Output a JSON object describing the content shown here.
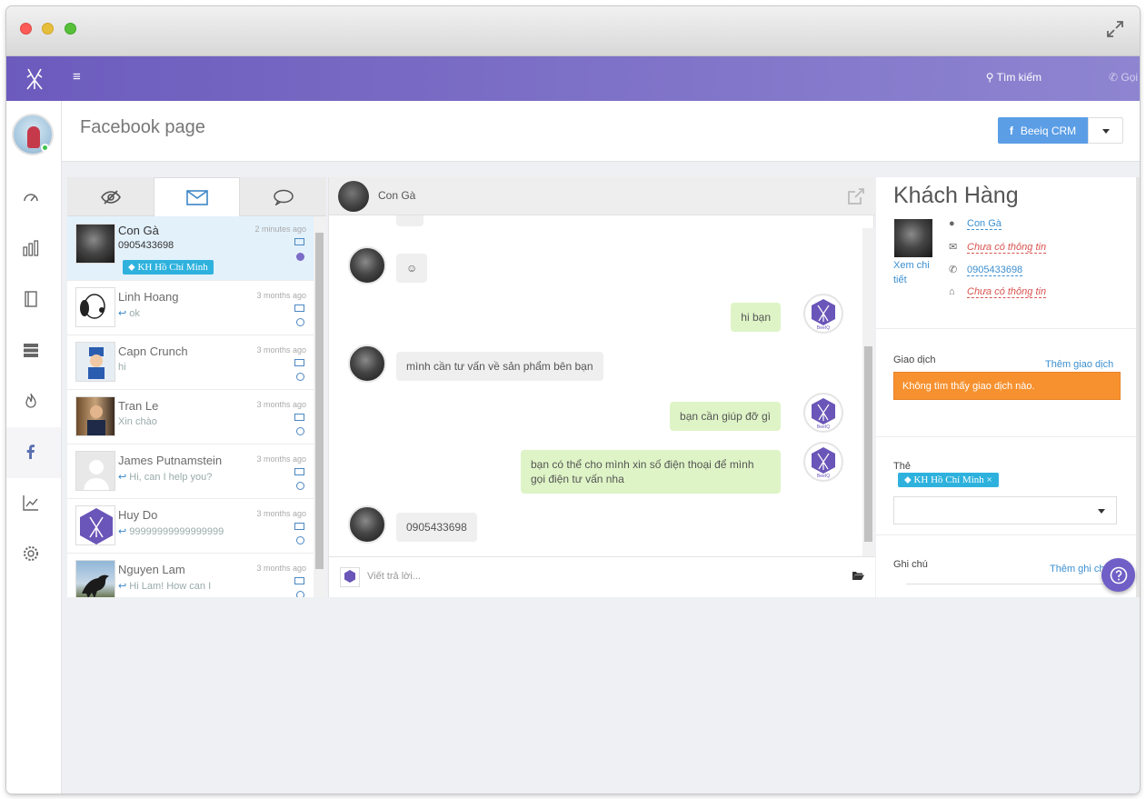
{
  "topnav": {
    "search_label": "Tìm kiếm",
    "call_label": "Gọi"
  },
  "header": {
    "title": "Facebook page",
    "crm_button": "Beeiq CRM"
  },
  "conversations": [
    {
      "name": "Con Gà",
      "preview": "0905433698",
      "time": "2 minutes ago",
      "tag": "KH Hồ Chí Minh",
      "active": true
    },
    {
      "name": "Linh Hoang",
      "preview": "ok",
      "time": "3 months ago",
      "replied": true
    },
    {
      "name": "Capn Crunch",
      "preview": "hi",
      "time": "3 months ago"
    },
    {
      "name": "Tran Le",
      "preview": "Xin chào",
      "time": "3 months ago"
    },
    {
      "name": "James Putnamstein",
      "preview": "Hi, can I help you?",
      "time": "3 months ago",
      "replied": true
    },
    {
      "name": "Huy Do",
      "preview": "99999999999999999",
      "time": "3 months ago",
      "replied": true
    },
    {
      "name": "Nguyen Lam",
      "preview": "Hi Lam! How can I",
      "time": "3 months ago",
      "replied": true
    }
  ],
  "chat": {
    "contact_name": "Con Gà",
    "bot_label": "BeeIQ",
    "messages": [
      {
        "from": "customer",
        "text": "☺"
      },
      {
        "from": "page",
        "text": "hi bạn"
      },
      {
        "from": "customer",
        "text": "mình cần tư vấn về sản phẩm bên bạn"
      },
      {
        "from": "page",
        "text": "bạn cần giúp đỡ gì"
      },
      {
        "from": "page",
        "text": "bạn có thể cho mình xin số điện thoại để mình gọi điện tư vấn nha"
      },
      {
        "from": "customer",
        "text": "0905433698"
      }
    ],
    "composer_placeholder": "Viết trả lời..."
  },
  "customer": {
    "title": "Khách Hàng",
    "view_detail": "Xem chi tiết",
    "name": "Con Gà",
    "email": "Chưa có thông tin",
    "phone": "0905433698",
    "address": "Chưa có thông tin"
  },
  "transactions": {
    "label": "Giao dịch",
    "add_link": "Thêm giao dịch",
    "empty_text": "Không tìm thấy giao dịch nào."
  },
  "tags": {
    "label": "Thẻ",
    "items": [
      "KH Hồ Chí Minh"
    ]
  },
  "notes": {
    "label": "Ghi chú",
    "add_link": "Thêm ghi chú"
  },
  "colors": {
    "brand": "#7b6cc7",
    "accent": "#5b9ee6",
    "tag": "#2eb2dd",
    "warning": "#f7912f",
    "outgoing_bubble": "#def4c6"
  }
}
